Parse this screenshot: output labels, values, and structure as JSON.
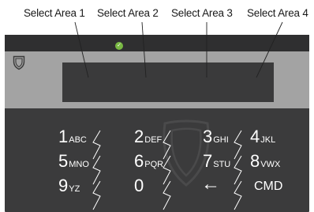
{
  "callouts": [
    {
      "id": "area1",
      "label": "Select Area 1"
    },
    {
      "id": "area2",
      "label": "Select Area 2"
    },
    {
      "id": "area3",
      "label": "Select Area 3"
    },
    {
      "id": "area4",
      "label": "Select Area 4"
    }
  ],
  "colors": {
    "device_body": "#3b3b3c",
    "screen_frame": "#a3a3a3",
    "display": "#3a3a3b",
    "status_led": "#79b843",
    "key_text": "#ffffff",
    "leader_line": "#ffffff"
  },
  "icons": {
    "status": "check-circle-icon",
    "badge": "shield-icon",
    "watermark": "shield-watermark-icon",
    "backspace": "left-arrow-icon"
  },
  "keys": {
    "k1": {
      "digit": "1",
      "letters": "ABC"
    },
    "k2": {
      "digit": "2",
      "letters": "DEF"
    },
    "k3": {
      "digit": "3",
      "letters": "GHI"
    },
    "k4": {
      "digit": "4",
      "letters": "JKL"
    },
    "k5": {
      "digit": "5",
      "letters": "MNO"
    },
    "k6": {
      "digit": "6",
      "letters": "PQR"
    },
    "k7": {
      "digit": "7",
      "letters": "STU"
    },
    "k8": {
      "digit": "8",
      "letters": "VWX"
    },
    "k9": {
      "digit": "9",
      "letters": "YZ"
    },
    "k0": {
      "digit": "0"
    },
    "back": {
      "symbol": "←"
    },
    "cmd": {
      "label": "CMD"
    }
  }
}
